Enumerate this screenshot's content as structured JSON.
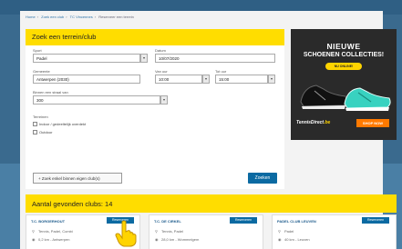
{
  "breadcrumb": [
    "Home",
    "Zoek een club",
    "TC Vincennes",
    "Reserveer een terrein"
  ],
  "search": {
    "title": "Zoek een terrein/club",
    "sport_label": "Sport",
    "sport_value": "Padel",
    "date_label": "Datum",
    "date_value": "10/07/2020",
    "location_label": "Gemeente",
    "location_value": "Antwerpen (2030)",
    "from_label": "Van uur",
    "from_value": "10:00",
    "to_label": "Tot uur",
    "to_value": "15:00",
    "radius_label": "Binnen een straal van",
    "radius_value": "300",
    "filters_label": "Terreinen",
    "filter1_label": "Indoor / gedeeltelijk overdekt",
    "filter2_label": "Outdoor",
    "add_club_label": "+ Zoek enkel binnen eigen club(s)",
    "submit_label": "Zoeken"
  },
  "ad": {
    "title1": "NIEUWE",
    "title2": "SCHOENEN COLLECTIES!",
    "pill": "NU ONLINE!",
    "brand": "TennisDirect",
    "brand_suffix": ".be",
    "cta": "SHOP NOW"
  },
  "results": {
    "title": "Aantal gevonden clubs: 14",
    "clubs": [
      {
        "name": "T.C. BORGERHOUT",
        "sports": "Tennis, Padel, Combi",
        "address": "0,2 km - Antwerpen",
        "button": "Reserveren"
      },
      {
        "name": "T.C. DE CIRKEL",
        "sports": "Tennis, Padel",
        "address": "28,0 km - Wommelgem",
        "button": "Reserveren"
      },
      {
        "name": "PADEL CLUB LEUVEN",
        "sports": "Padel",
        "address": "40 km - Leuven",
        "button": "Reserveren"
      }
    ]
  },
  "colors": {
    "accent": "#ffdd00",
    "primary": "#0b6aa2"
  }
}
